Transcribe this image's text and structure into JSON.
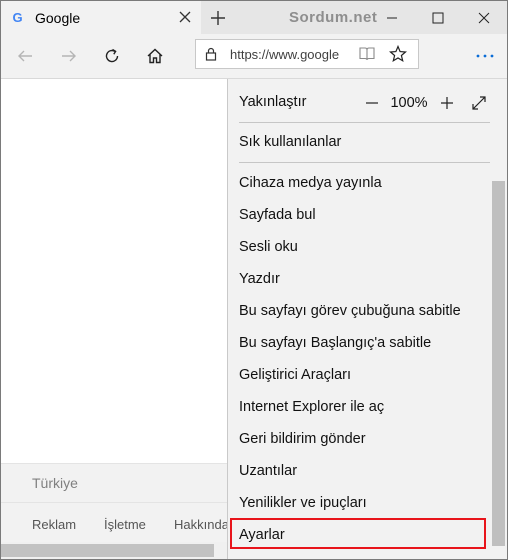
{
  "tab": {
    "title": "Google",
    "favicon_letter": "G"
  },
  "titlebar": {
    "watermark": "Sordum.net"
  },
  "address": {
    "url": "https://www.google"
  },
  "menu": {
    "zoom_label": "Yakınlaştır",
    "zoom_value": "100%",
    "favorites": "Sık kullanılanlar",
    "items": [
      "Cihaza medya yayınla",
      "Sayfada bul",
      "Sesli oku",
      "Yazdır",
      "Bu sayfayı görev çubuğuna sabitle",
      "Bu sayfayı Başlangıç'a sabitle",
      "Geliştirici Araçları",
      "Internet Explorer ile aç",
      "Geri bildirim gönder",
      "Uzantılar",
      "Yenilikler ve ipuçları",
      "Ayarlar"
    ],
    "highlight_color": "#e8141b"
  },
  "footer": {
    "country": "Türkiye",
    "links": [
      "Reklam",
      "İşletme",
      "Hakkında"
    ]
  },
  "icons": [
    "close-icon",
    "new-tab-icon",
    "minimize-icon",
    "maximize-icon",
    "window-close-icon",
    "back-icon",
    "forward-icon",
    "refresh-icon",
    "home-icon",
    "lock-icon",
    "reading-view-icon",
    "favorite-star-icon",
    "more-icon",
    "zoom-out-icon",
    "zoom-in-icon",
    "fullscreen-icon"
  ]
}
